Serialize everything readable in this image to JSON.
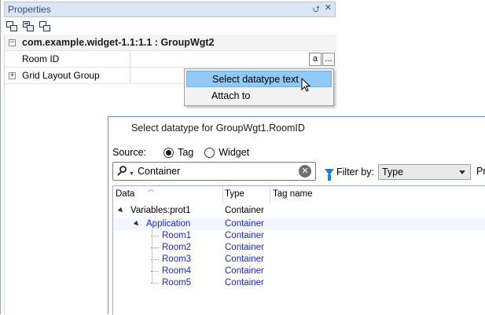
{
  "properties_panel": {
    "title": "Properties",
    "pin_glyph": "⮍",
    "close_glyph": "✕",
    "toolbar_icons": [
      "categorized-view-icon",
      "alphabetical-view-icon",
      "property-pages-icon"
    ],
    "object_header": "com.example.widget-1.1:1.1 : GroupWgt2",
    "rows": [
      {
        "name": "Room ID",
        "value_button_a": "a",
        "value_button_more": "..."
      },
      {
        "name": "Grid Layout Group"
      }
    ]
  },
  "context_menu": {
    "items": [
      {
        "label": "Select datatype text",
        "highlighted": true
      },
      {
        "label": "Attach to",
        "highlighted": false
      }
    ]
  },
  "dialog": {
    "title": "Select datatype for GroupWgt1.RoomID",
    "source_label": "Source:",
    "source_options": [
      {
        "label": "Tag",
        "selected": true
      },
      {
        "label": "Widget",
        "selected": false
      }
    ],
    "search": {
      "value": "Container"
    },
    "filter_label": "Filter by:",
    "filter_value": "Type",
    "cut_label": "Pr",
    "columns": [
      "Data",
      "Type",
      "Tag name"
    ],
    "rows": [
      {
        "data": "Variables:prot1",
        "type": "Container",
        "tag": "",
        "level": 0,
        "expanded": true,
        "blue": false
      },
      {
        "data": "Application",
        "type": "Container",
        "tag": "",
        "level": 1,
        "expanded": true,
        "blue": true
      },
      {
        "data": "Room1",
        "type": "Container",
        "tag": "",
        "level": 2,
        "blue": true
      },
      {
        "data": "Room2",
        "type": "Container",
        "tag": "",
        "level": 2,
        "blue": true
      },
      {
        "data": "Room3",
        "type": "Container",
        "tag": "",
        "level": 2,
        "blue": true
      },
      {
        "data": "Room4",
        "type": "Container",
        "tag": "",
        "level": 2,
        "blue": true
      },
      {
        "data": "Room5",
        "type": "Container",
        "tag": "",
        "level": 2,
        "blue": true
      }
    ]
  },
  "colors": {
    "panel_title_bg": "#dbe5f3",
    "menu_highlight": "#91c9f7",
    "tree_link": "#1a25c9",
    "filter_icon": "#1f7fd1"
  }
}
